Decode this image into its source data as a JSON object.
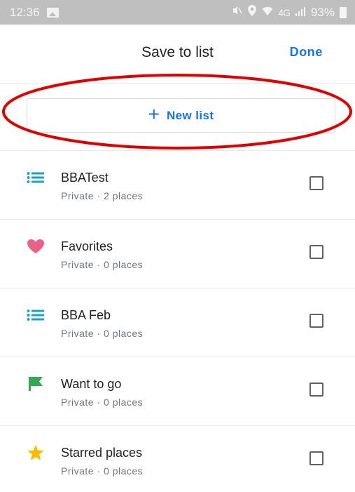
{
  "status_bar": {
    "time": "12:36",
    "signal_text": "4G",
    "battery": "93%",
    "gallery_icon": "gallery-icon",
    "icons": [
      "mute-icon",
      "location-icon",
      "wifi-icon",
      "signal-icon",
      "battery-icon"
    ]
  },
  "header": {
    "title": "Save to list",
    "done_label": "Done"
  },
  "new_list": {
    "plus": "+",
    "label": "New list",
    "annotation_color": "#e00000"
  },
  "lists": [
    {
      "name": "BBATest",
      "meta": "Private · 2 places",
      "icon": "list-icon",
      "icon_color": "#1aa3c5",
      "checked": false
    },
    {
      "name": "Favorites",
      "meta": "Private · 0 places",
      "icon": "heart-icon",
      "icon_color": "#ec5f87",
      "checked": false
    },
    {
      "name": "BBA Feb",
      "meta": "Private · 0 places",
      "icon": "list-icon",
      "icon_color": "#1aa3c5",
      "checked": false
    },
    {
      "name": "Want to go",
      "meta": "Private · 0 places",
      "icon": "flag-icon",
      "icon_color": "#34a853",
      "checked": false
    },
    {
      "name": "Starred places",
      "meta": "Private · 0 places",
      "icon": "star-icon",
      "icon_color": "#fbbc04",
      "checked": false
    }
  ],
  "colors": {
    "accent": "#1a73e8",
    "divider": "#e8e8e8"
  }
}
